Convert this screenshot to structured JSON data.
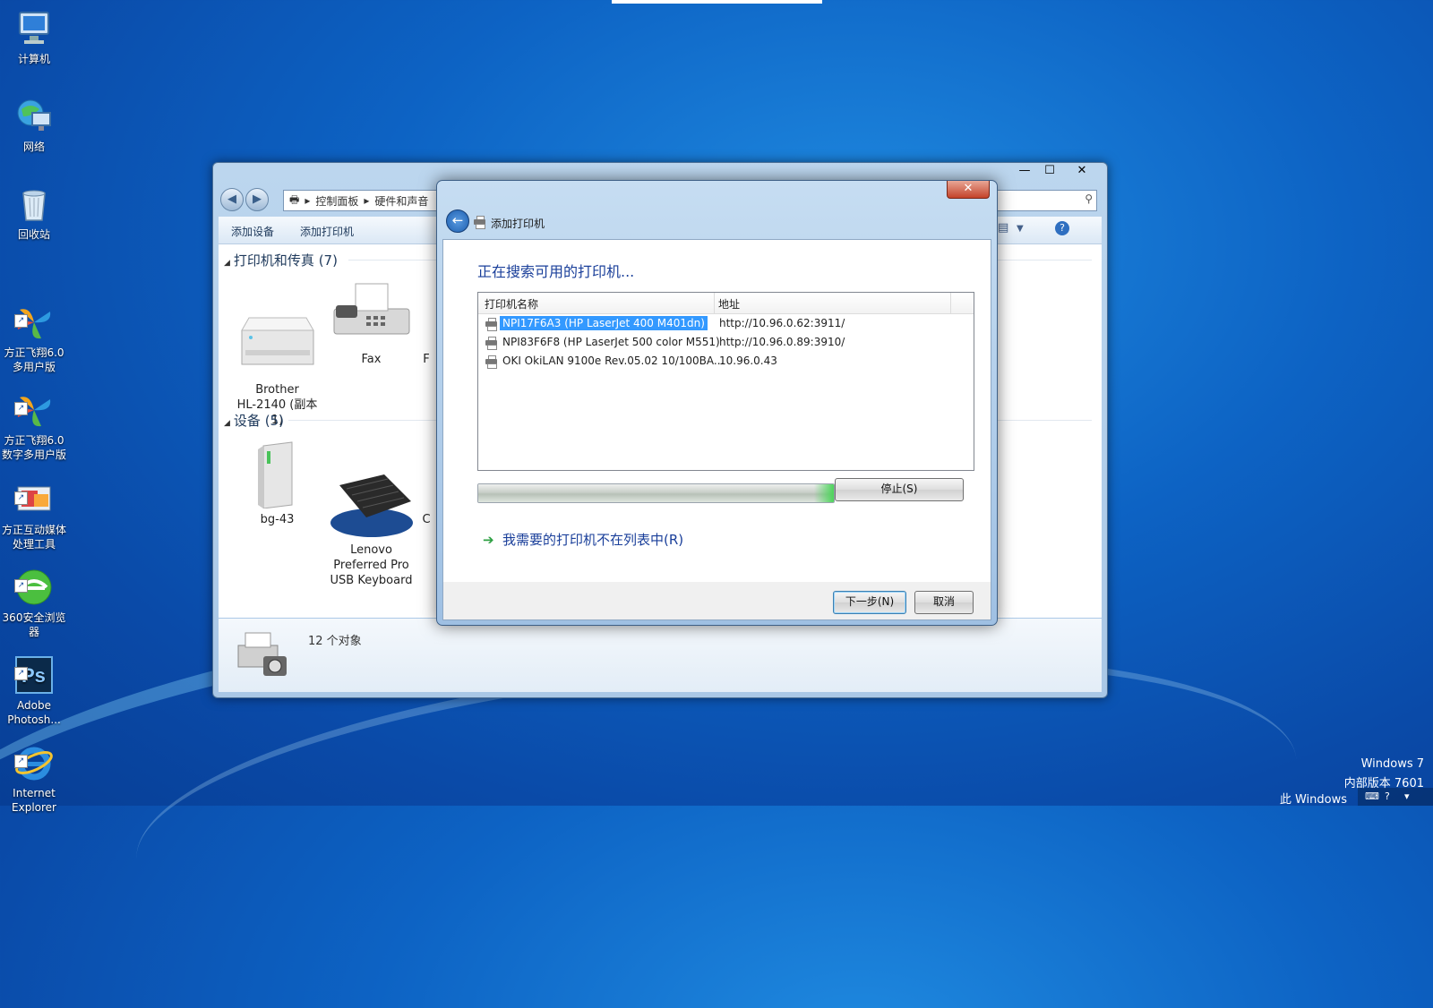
{
  "desktop": {
    "icons": [
      {
        "label": "计算机",
        "icon": "computer-icon"
      },
      {
        "label": "网络",
        "icon": "network-icon"
      },
      {
        "label": "回收站",
        "icon": "recycle-bin-icon"
      },
      {
        "label": "方正飞翔6.0\n多用户版",
        "icon": "founder-feixiang-icon"
      },
      {
        "label": "方正飞翔6.0\n数字多用户版",
        "icon": "founder-feixiang-digital-icon"
      },
      {
        "label": "方正互动媒体\n处理工具",
        "icon": "founder-media-tool-icon"
      },
      {
        "label": "360安全浏览\n器",
        "icon": "360-browser-icon"
      },
      {
        "label": "Adobe\nPhotosh...",
        "icon": "photoshop-icon"
      },
      {
        "label": "Internet\nExplorer",
        "icon": "internet-explorer-icon"
      }
    ],
    "watermark_line1": "Windows 7",
    "watermark_line2": "内部版本 7601",
    "watermark_line3": "此 Windows"
  },
  "explorer": {
    "breadcrumb": [
      "控制面板",
      "硬件和声音"
    ],
    "toolbar": {
      "add_device": "添加设备",
      "add_printer": "添加打印机"
    },
    "groups": [
      {
        "title": "打印机和传真 (7)",
        "items": [
          {
            "label": "Brother\nHL-2140 (副本\n1)",
            "icon": "laser-printer-icon"
          },
          {
            "label": "Fax",
            "icon": "fax-icon"
          },
          {
            "label": "F",
            "icon": "printer-icon"
          }
        ]
      },
      {
        "title": "设备 (5)",
        "items": [
          {
            "label": "bg-43",
            "icon": "pc-tower-icon"
          },
          {
            "label": "Lenovo\nPreferred Pro\nUSB Keyboard",
            "icon": "keyboard-icon"
          },
          {
            "label": "C",
            "icon": "device-icon"
          }
        ]
      }
    ],
    "status": {
      "count": "12 个对象"
    },
    "window_controls": {
      "minimize": "—",
      "maximize": "☐",
      "close": "✕"
    }
  },
  "dialog": {
    "title": "添加打印机",
    "heading": "正在搜索可用的打印机...",
    "columns": {
      "name": "打印机名称",
      "address": "地址"
    },
    "printers": [
      {
        "name": "NPI17F6A3 (HP LaserJet 400 M401dn)",
        "address": "http://10.96.0.62:3911/",
        "selected": true
      },
      {
        "name": "NPI83F6F8 (HP LaserJet 500 color M551)",
        "address": "http://10.96.0.89:3910/",
        "selected": false
      },
      {
        "name": "OKI OkiLAN 9100e Rev.05.02 10/100BA...",
        "address": "10.96.0.43",
        "selected": false
      }
    ],
    "progress": 1.0,
    "stop_label": "停止(S)",
    "not_listed_link": "我需要的打印机不在列表中(R)",
    "next_label": "下一步(N)",
    "cancel_label": "取消",
    "close_glyph": "✕"
  },
  "colors": {
    "accent": "#3399ff",
    "link": "#1a3f9a",
    "close": "#c4432a"
  }
}
